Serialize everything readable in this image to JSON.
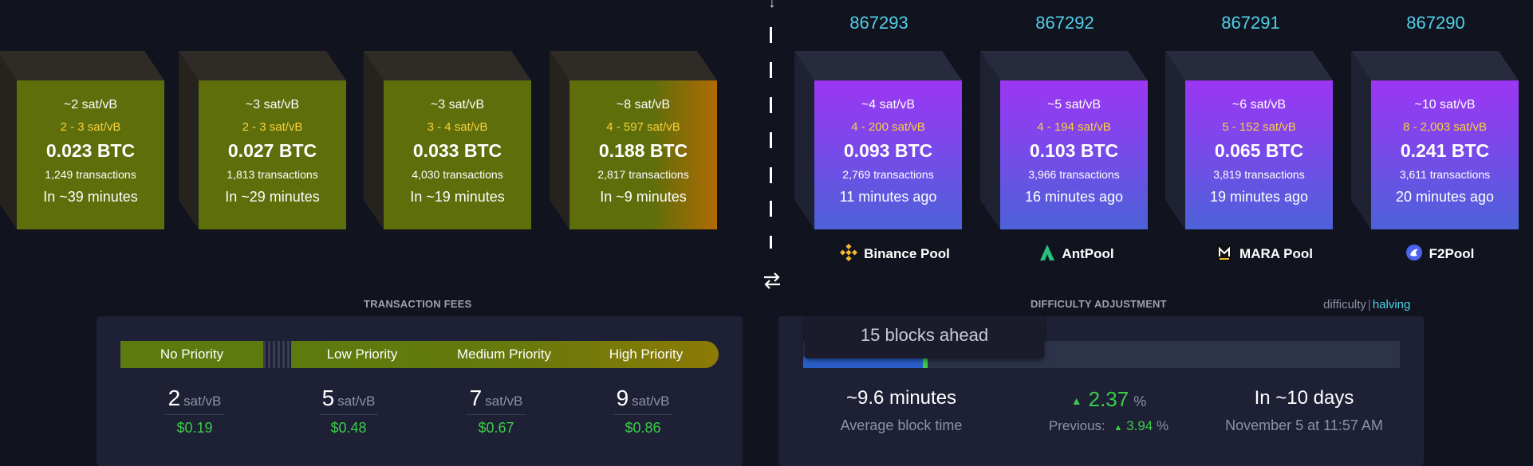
{
  "colors": {
    "accent_cyan": "#4fd0e8",
    "fee_yellow": "#f9d13b",
    "green": "#3bcc49",
    "mempool_face": "#5d6e0b",
    "mined_gradient_top": "#9c36f3",
    "mined_gradient_bottom": "#4c62d8"
  },
  "mempool_blocks": [
    {
      "median_fee": "~2 sat/vB",
      "fee_range": "2 - 3 sat/vB",
      "total": "0.023 BTC",
      "tx_count": "1,249 transactions",
      "eta": "In ~39 minutes"
    },
    {
      "median_fee": "~3 sat/vB",
      "fee_range": "2 - 3 sat/vB",
      "total": "0.027 BTC",
      "tx_count": "1,813 transactions",
      "eta": "In ~29 minutes"
    },
    {
      "median_fee": "~3 sat/vB",
      "fee_range": "3 - 4 sat/vB",
      "total": "0.033 BTC",
      "tx_count": "4,030 transactions",
      "eta": "In ~19 minutes"
    },
    {
      "median_fee": "~8 sat/vB",
      "fee_range": "4 - 597 sat/vB",
      "total": "0.188 BTC",
      "tx_count": "2,817 transactions",
      "eta": "In ~9 minutes"
    }
  ],
  "mined_blocks": [
    {
      "height": "867293",
      "median_fee": "~4 sat/vB",
      "fee_range": "4 - 200 sat/vB",
      "total": "0.093 BTC",
      "tx_count": "2,769 transactions",
      "age": "11 minutes ago",
      "pool": "Binance Pool",
      "pool_icon": "binance-icon"
    },
    {
      "height": "867292",
      "median_fee": "~5 sat/vB",
      "fee_range": "4 - 194 sat/vB",
      "total": "0.103 BTC",
      "tx_count": "3,966 transactions",
      "age": "16 minutes ago",
      "pool": "AntPool",
      "pool_icon": "antpool-icon"
    },
    {
      "height": "867291",
      "median_fee": "~6 sat/vB",
      "fee_range": "5 - 152 sat/vB",
      "total": "0.065 BTC",
      "tx_count": "3,819 transactions",
      "age": "19 minutes ago",
      "pool": "MARA Pool",
      "pool_icon": "mara-icon"
    },
    {
      "height": "867290",
      "median_fee": "~10 sat/vB",
      "fee_range": "8 - 2,003 sat/vB",
      "total": "0.241 BTC",
      "tx_count": "3,611 transactions",
      "age": "20 minutes ago",
      "pool": "F2Pool",
      "pool_icon": "f2pool-icon"
    }
  ],
  "transaction_fees": {
    "title": "TRANSACTION FEES",
    "tiers": [
      {
        "label": "No Priority",
        "value": "2",
        "unit": "sat/vB",
        "usd": "$0.19"
      },
      {
        "label": "Low Priority",
        "value": "5",
        "unit": "sat/vB",
        "usd": "$0.48"
      },
      {
        "label": "Medium Priority",
        "value": "7",
        "unit": "sat/vB",
        "usd": "$0.67"
      },
      {
        "label": "High Priority",
        "value": "9",
        "unit": "sat/vB",
        "usd": "$0.86"
      }
    ]
  },
  "difficulty": {
    "title": "DIFFICULTY ADJUSTMENT",
    "toggle_difficulty": "difficulty",
    "toggle_separator": "|",
    "toggle_halving": "halving",
    "tooltip": "15 blocks ahead",
    "avg_block_time": "~9.6 minutes",
    "avg_block_time_label": "Average block time",
    "change_value": "2.37",
    "change_unit": "%",
    "previous_label": "Previous:",
    "previous_value": "3.94",
    "previous_unit": "%",
    "eta": "In ~10 days",
    "eta_date": "November 5 at 11:57 AM"
  }
}
